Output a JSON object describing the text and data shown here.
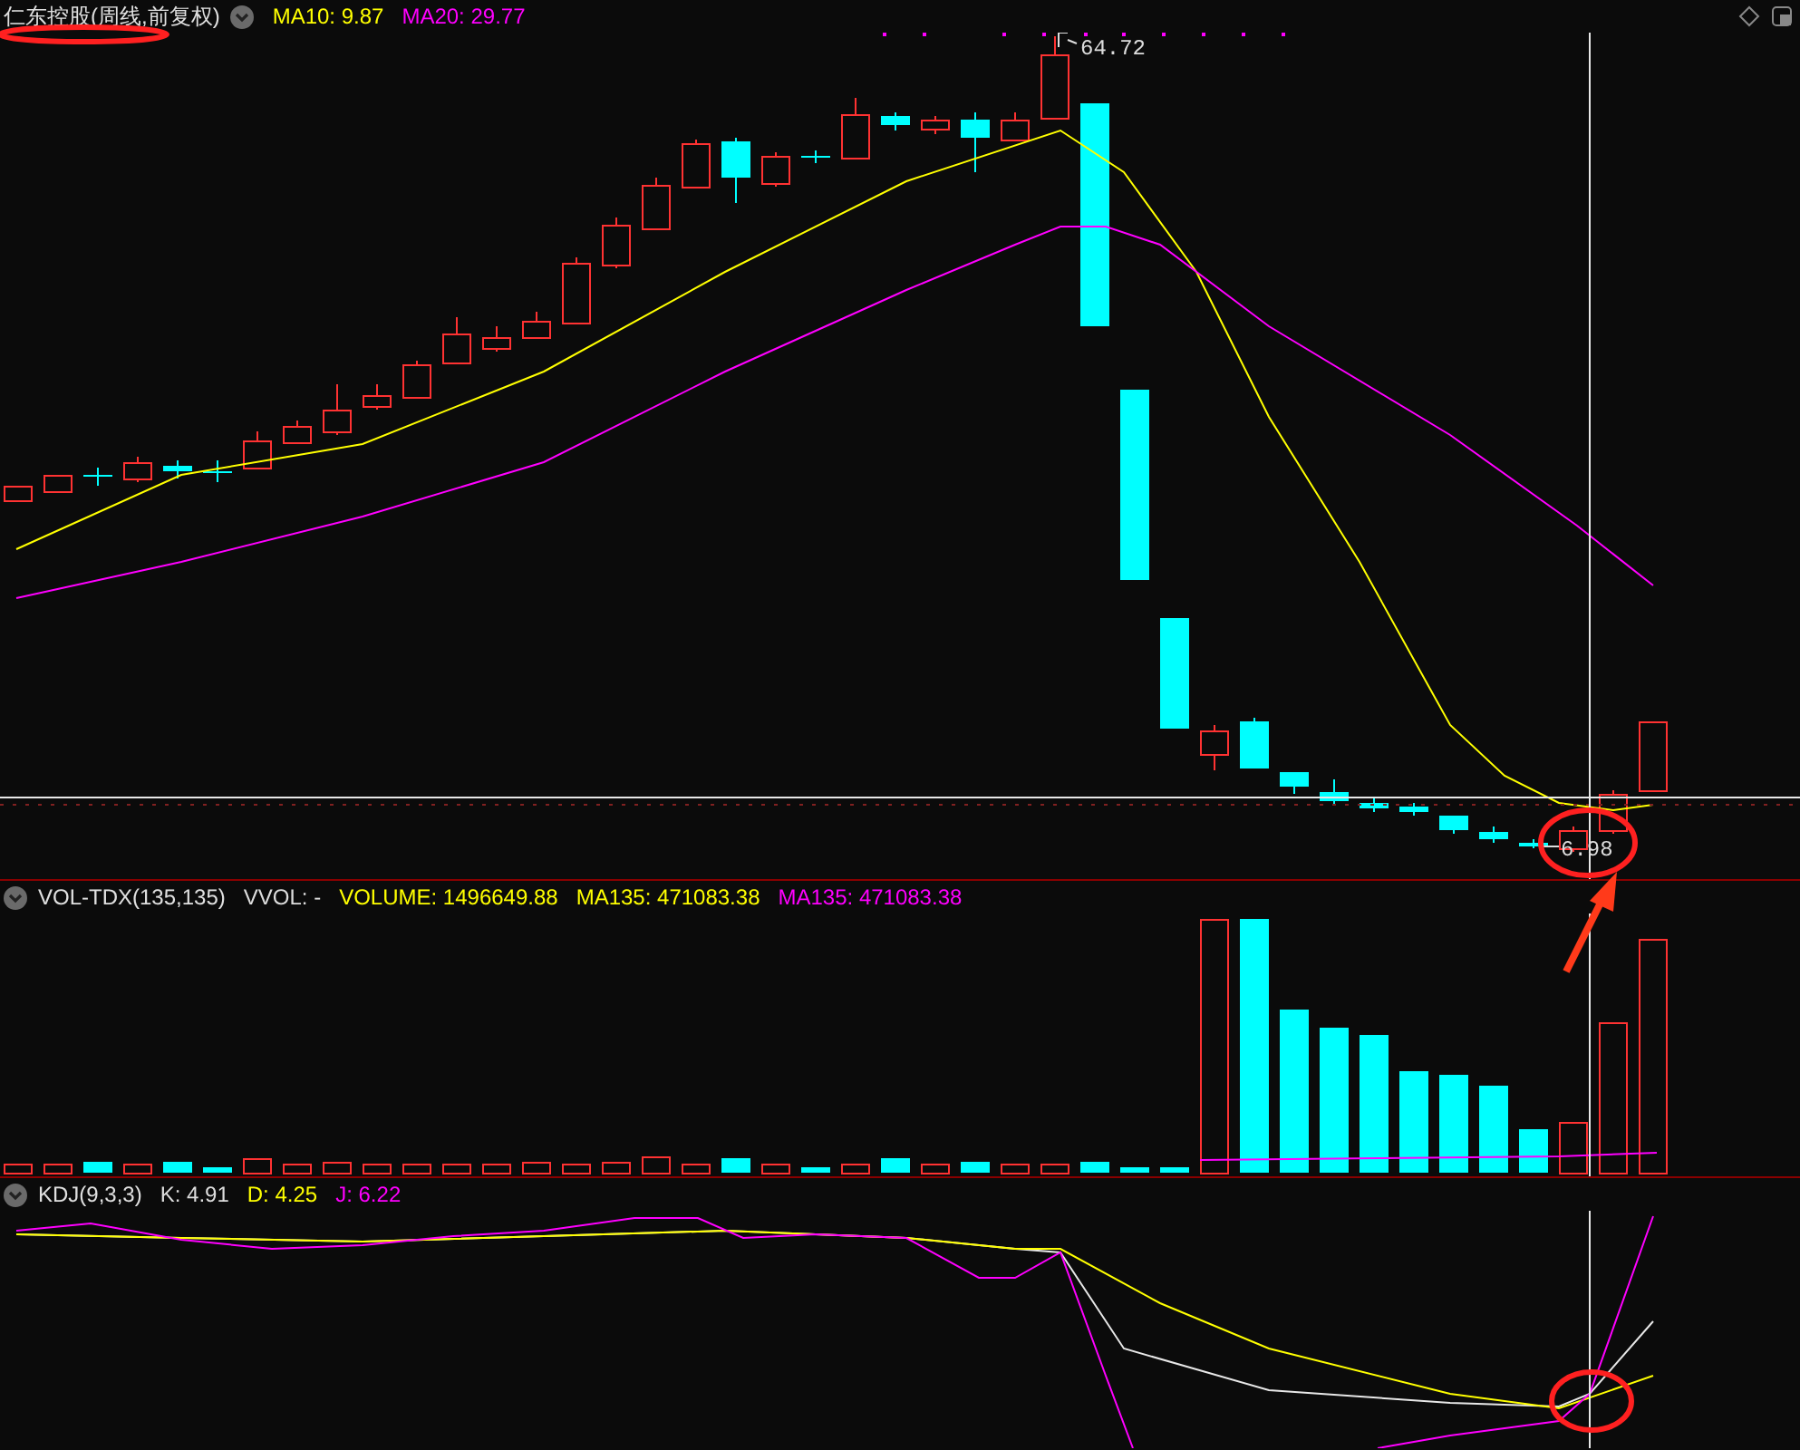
{
  "price_panel": {
    "title": "仁东控股(周线,前复权)",
    "indicators": [
      {
        "label": "MA10: 9.87",
        "color": "#ffff00"
      },
      {
        "label": "MA20: 29.77",
        "color": "#ff00ff"
      }
    ],
    "high_label": "64.72",
    "low_label": "6.98"
  },
  "volume_panel": {
    "title": "VOL-TDX(135,135)",
    "indicators": [
      {
        "label": "VVOL: -",
        "color": "#dddddd"
      },
      {
        "label": "VOLUME: 1496649.88",
        "color": "#ffff00"
      },
      {
        "label": "MA135: 471083.38",
        "color": "#ffff00"
      },
      {
        "label": "MA135: 471083.38",
        "color": "#ff00ff"
      }
    ]
  },
  "kdj_panel": {
    "title": "KDJ(9,3,3)",
    "indicators": [
      {
        "label": "K: 4.91",
        "color": "#dddddd"
      },
      {
        "label": "D: 4.25",
        "color": "#ffff00"
      },
      {
        "label": "J: 6.22",
        "color": "#ff00ff"
      }
    ]
  }
}
